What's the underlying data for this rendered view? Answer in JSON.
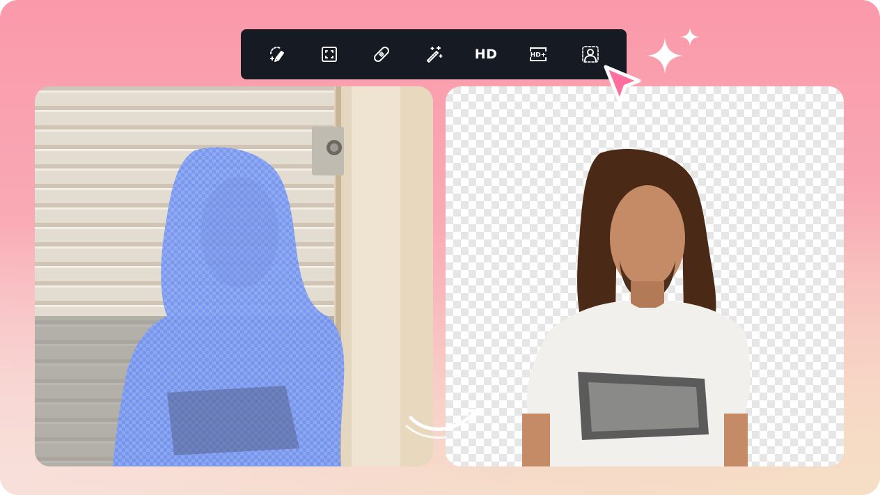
{
  "toolbar": {
    "tools": [
      {
        "name": "brush-select-tool",
        "icon": "brush-sparkle-icon"
      },
      {
        "name": "crop-tool",
        "icon": "crop-frame-icon"
      },
      {
        "name": "heal-tool",
        "icon": "bandage-icon"
      },
      {
        "name": "magic-wand-tool",
        "icon": "magic-wand-icon"
      },
      {
        "name": "hd-tool",
        "label": "HD"
      },
      {
        "name": "hd-plus-tool",
        "label": "HD+"
      },
      {
        "name": "portrait-cutout-tool",
        "icon": "person-cutout-icon"
      }
    ],
    "active_tool": "portrait-cutout-tool"
  },
  "panels": {
    "before": {
      "name": "original-photo",
      "overlay_color": "#6f8ff2"
    },
    "after": {
      "name": "background-removed-result",
      "background": "transparent-checkerboard"
    }
  },
  "colors": {
    "toolbar_bg": "#151a23",
    "cursor": "#ff6f9e",
    "page_gradient_top": "#fa99aa",
    "page_gradient_bottom": "#f6dccc"
  }
}
